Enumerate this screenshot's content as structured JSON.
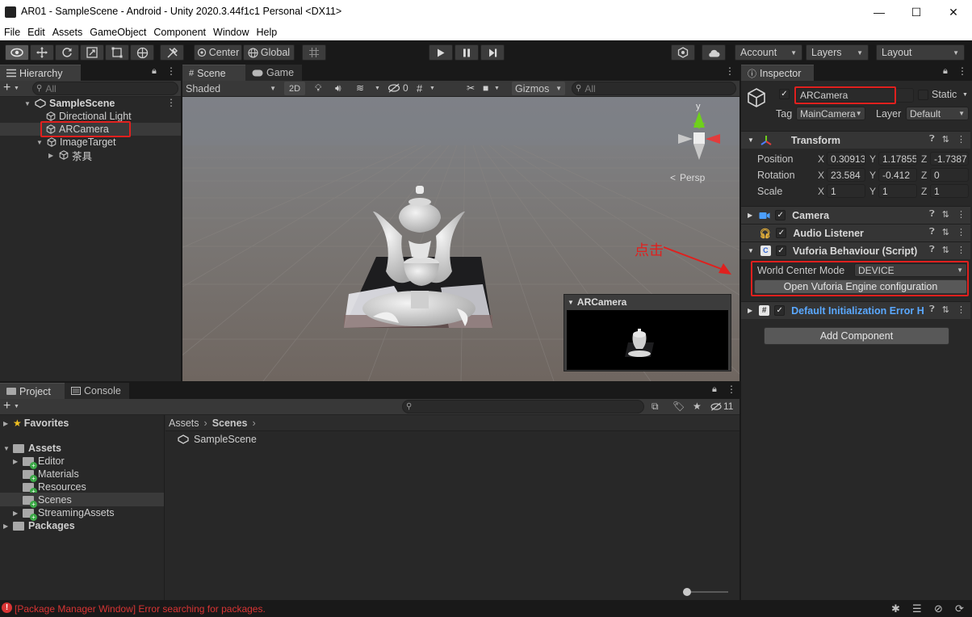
{
  "window": {
    "title": "AR01 - SampleScene - Android - Unity 2020.3.44f1c1 Personal <DX11>",
    "minimize_glyph": "—",
    "maximize_glyph": "☐",
    "close_glyph": "✕"
  },
  "menu": [
    "File",
    "Edit",
    "Assets",
    "GameObject",
    "Component",
    "Window",
    "Help"
  ],
  "toolbar": {
    "pivot_label": "Center",
    "space_label": "Global",
    "account_label": "Account",
    "layers_label": "Layers",
    "layout_label": "Layout"
  },
  "hierarchy": {
    "tab_label": "Hierarchy",
    "search_placeholder": "All",
    "scene_name": "SampleScene",
    "items": [
      "Directional Light",
      "ARCamera",
      "ImageTarget",
      "茶具"
    ]
  },
  "scene_view": {
    "tab_scene": "Scene",
    "tab_game": "Game",
    "shading_mode": "Shaded",
    "mode_2d": "2D",
    "hidden_count": "0",
    "gizmos_label": "Gizmos",
    "search_placeholder": "All",
    "gizmo_axis_y": "y",
    "projection_label": "Persp",
    "camera_preview_title": "ARCamera",
    "annotation_text": "点击"
  },
  "project": {
    "tab_project": "Project",
    "tab_console": "Console",
    "hidden_count": "11",
    "favorites_label": "Favorites",
    "assets_label": "Assets",
    "folders": [
      "Editor",
      "Materials",
      "Resources",
      "Scenes",
      "StreamingAssets"
    ],
    "packages_label": "Packages",
    "breadcrumb": [
      "Assets",
      "Scenes"
    ],
    "files": [
      "SampleScene"
    ]
  },
  "inspector": {
    "tab_label": "Inspector",
    "object_name": "ARCamera",
    "static_label": "Static",
    "tag_label": "Tag",
    "tag_value": "MainCamera",
    "layer_label": "Layer",
    "layer_value": "Default",
    "transform": {
      "title": "Transform",
      "rows": [
        {
          "label": "Position",
          "x": "0.30913",
          "y": "1.17855",
          "z": "-1.7387"
        },
        {
          "label": "Rotation",
          "x": "23.584",
          "y": "-0.412",
          "z": "0"
        },
        {
          "label": "Scale",
          "x": "1",
          "y": "1",
          "z": "1"
        }
      ]
    },
    "components": {
      "camera": "Camera",
      "audio": "Audio Listener",
      "vuforia": "Vuforia Behaviour (Script)",
      "default_init": "Default Initialization Error H"
    },
    "world_center_mode_label": "World Center Mode",
    "world_center_mode_value": "DEVICE",
    "open_config_label": "Open Vuforia Engine configuration",
    "add_component_label": "Add Component"
  },
  "status": {
    "message": "[Package Manager Window] Error searching for packages."
  },
  "colors": {
    "accent_blue": "#4c7eff",
    "annotation_red": "#e0201e",
    "error_red": "#d83434",
    "link_blue": "#5aa8ff"
  }
}
